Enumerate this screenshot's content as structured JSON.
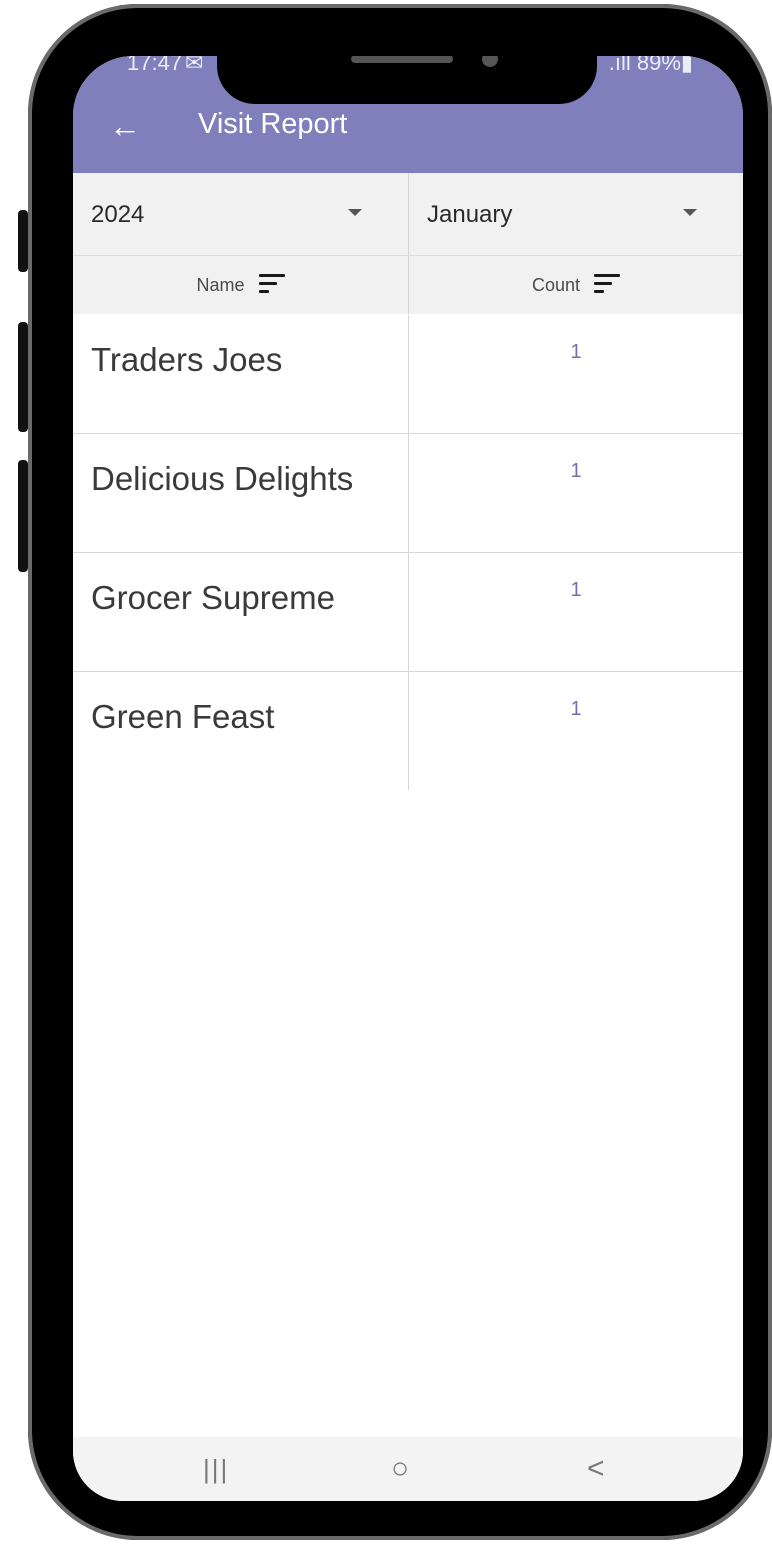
{
  "status_bar": {
    "time": "17:47",
    "left_icons": "✉",
    "right_text": ".ıll 89%▮"
  },
  "app_bar": {
    "back_icon": "←",
    "title": "Visit Report"
  },
  "filters": {
    "year": "2024",
    "month": "January"
  },
  "table": {
    "columns": [
      "Name",
      "Count"
    ],
    "rows": [
      {
        "name": "Traders Joes",
        "count": "1"
      },
      {
        "name": "Delicious Delights",
        "count": "1"
      },
      {
        "name": "Grocer Supreme",
        "count": "1"
      },
      {
        "name": "Green Feast",
        "count": "1"
      }
    ]
  },
  "nav_bar": {
    "recents": "|||",
    "home": "○",
    "back": "<"
  },
  "colors": {
    "app_bar": "#7e7fbb",
    "count_text": "#6f70b0"
  }
}
